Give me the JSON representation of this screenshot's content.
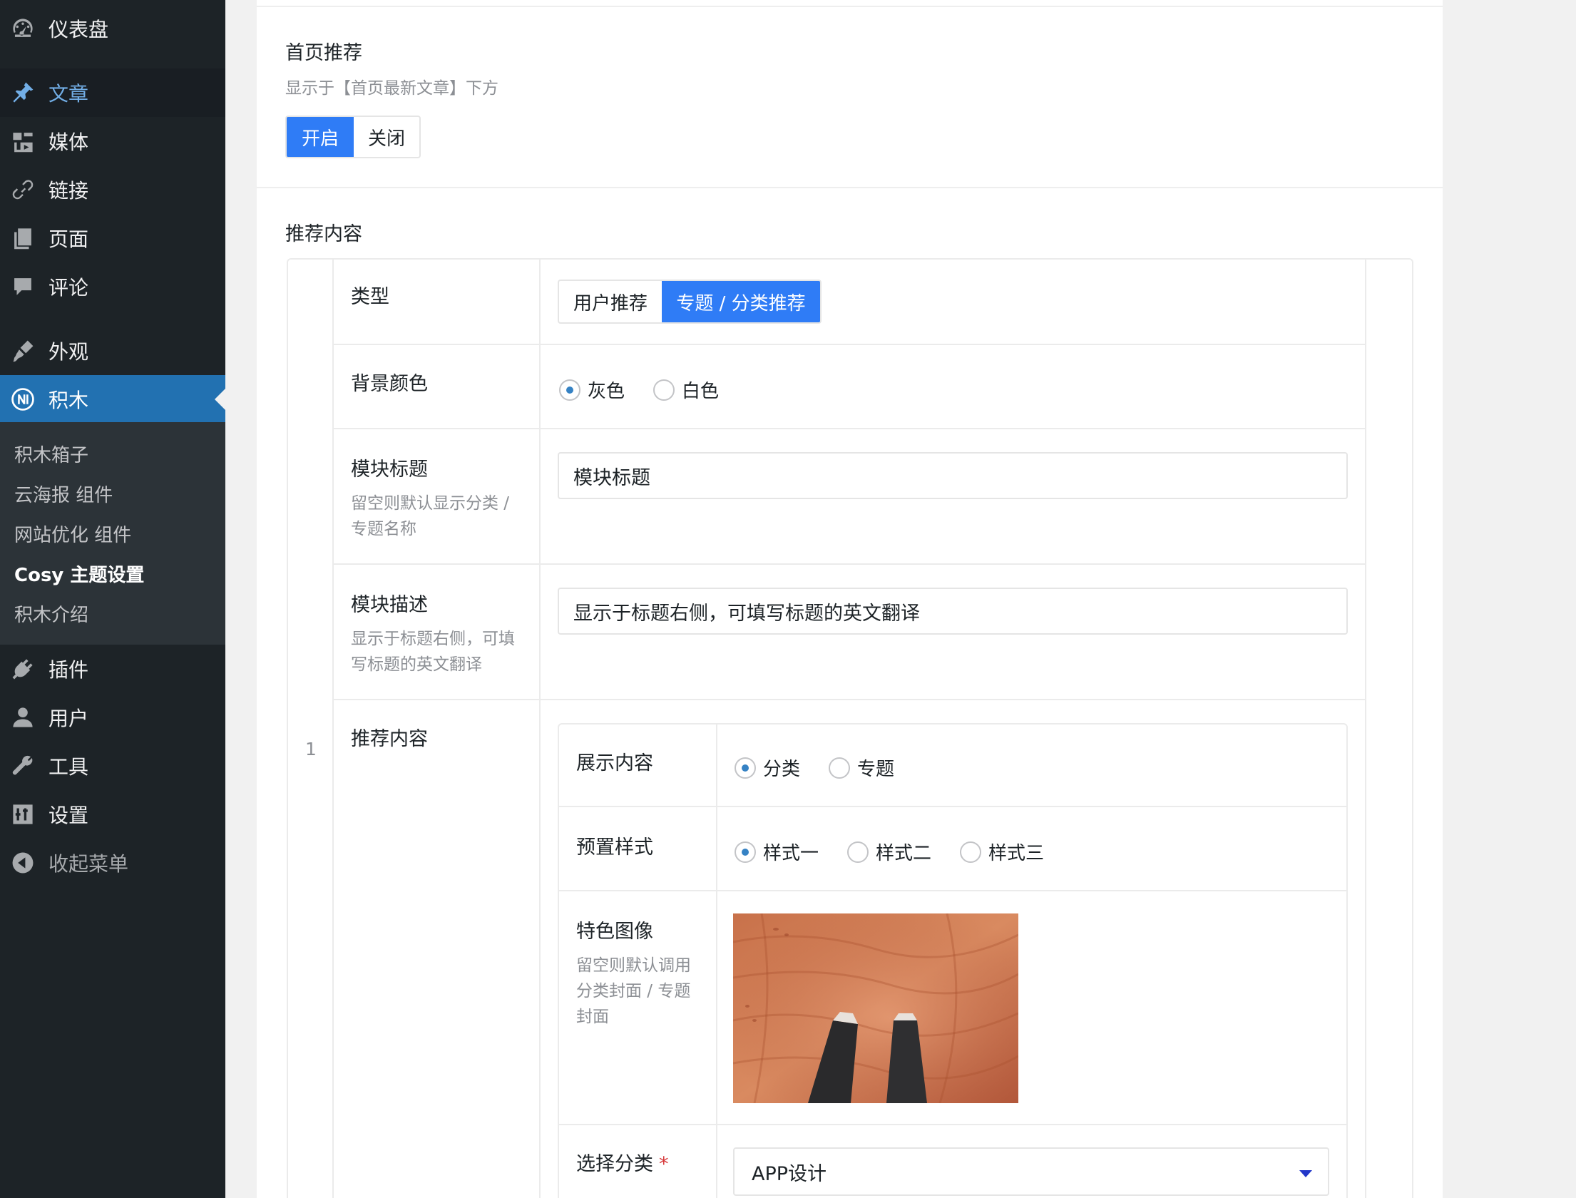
{
  "sidebar": {
    "dashboard": "仪表盘",
    "posts": "文章",
    "media": "媒体",
    "links": "链接",
    "pages": "页面",
    "comments": "评论",
    "appearance": "外观",
    "jimu": "积木",
    "submenu": [
      "积木箱子",
      "云海报 组件",
      "网站优化 组件",
      "Cosy 主题设置",
      "积木介绍"
    ],
    "plugins": "插件",
    "users": "用户",
    "tools": "工具",
    "settings": "设置",
    "collapse": "收起菜单"
  },
  "home_recommend": {
    "title": "首页推荐",
    "desc": "显示于【首页最新文章】下方",
    "on_label": "开启",
    "off_label": "关闭"
  },
  "recommend_content": {
    "title": "推荐内容",
    "index": "1",
    "type": {
      "label": "类型",
      "options": [
        "用户推荐",
        "专题 / 分类推荐"
      ],
      "selected": "专题 / 分类推荐"
    },
    "bg_color": {
      "label": "背景颜色",
      "options": [
        "灰色",
        "白色"
      ],
      "selected": "灰色"
    },
    "module_title": {
      "label": "模块标题",
      "desc_line1": "留空则默认显示分类 /",
      "desc_line2": "专题名称",
      "value": "模块标题"
    },
    "module_desc": {
      "label": "模块描述",
      "desc_line1": "显示于标题右侧，可填",
      "desc_line2": "写标题的英文翻译",
      "value": "显示于标题右侧，可填写标题的英文翻译"
    },
    "inner": {
      "label": "推荐内容",
      "display": {
        "label": "展示内容",
        "options": [
          "分类",
          "专题"
        ],
        "selected": "分类"
      },
      "preset": {
        "label": "预置样式",
        "options": [
          "样式一",
          "样式二",
          "样式三"
        ],
        "selected": "样式一"
      },
      "feature_image": {
        "label": "特色图像",
        "desc_line1": "留空则默认调用",
        "desc_line2": "分类封面 / 专题",
        "desc_line3": "封面"
      },
      "category": {
        "label": "选择分类",
        "required_mark": "*",
        "value": "APP设计"
      }
    }
  },
  "colors": {
    "primary": "#2f7cf6",
    "sidebar_bg": "#1d2327",
    "menu_current": "#2271b1",
    "submenu_bg": "#2c3338"
  }
}
